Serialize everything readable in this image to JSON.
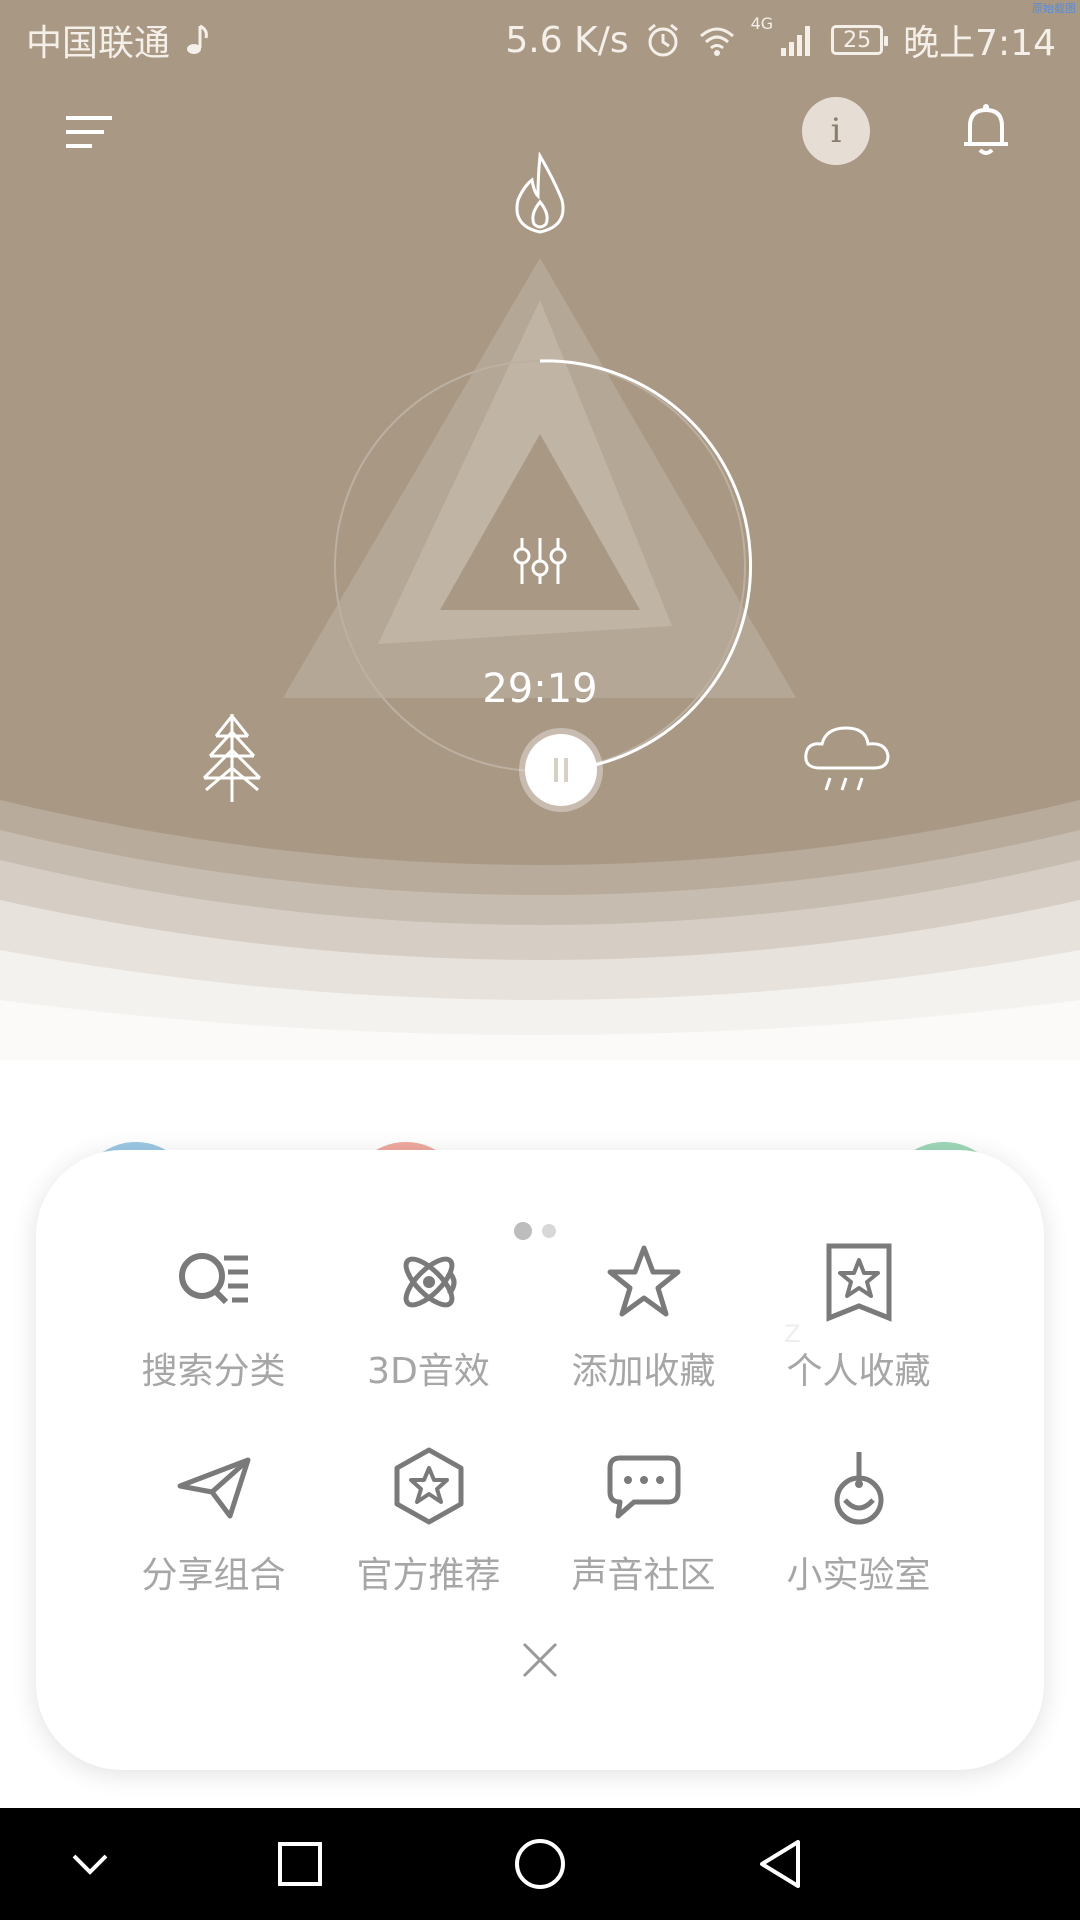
{
  "status_bar": {
    "carrier": "中国联通",
    "speed": "5.6 K/s",
    "network": "4G",
    "battery": "25",
    "time": "晚上7:14",
    "corner_tag": "原始截图"
  },
  "header": {
    "menu_icon": "menu-icon",
    "info_label": "i",
    "bell_icon": "bell-icon"
  },
  "player": {
    "timer": "29:19",
    "progress_fraction": 0.4,
    "state": "playing",
    "sounds": [
      "fire-icon",
      "tree-icon",
      "rain-icon"
    ]
  },
  "colors": {
    "hero_bg": "#a99984",
    "card_bg": "#ffffff",
    "label": "#a6a6a6",
    "icon": "#7a7a7a",
    "peek_blue": "#9cc9e6",
    "peek_red": "#f0a9a0",
    "peek_green": "#9fd8b9"
  },
  "menu": {
    "page_dots": 2,
    "active_page": 1,
    "items": [
      {
        "label": "搜索分类",
        "icon": "search-list-icon"
      },
      {
        "label": "3D音效",
        "icon": "atom-icon"
      },
      {
        "label": "添加收藏",
        "icon": "star-icon"
      },
      {
        "label": "个人收藏",
        "icon": "bookmark-star-icon"
      },
      {
        "label": "分享组合",
        "icon": "paper-plane-icon"
      },
      {
        "label": "官方推荐",
        "icon": "hexagon-star-icon"
      },
      {
        "label": "声音社区",
        "icon": "chat-bubble-icon"
      },
      {
        "label": "小实验室",
        "icon": "flask-icon"
      }
    ],
    "faint_text": "Z"
  },
  "nav_bar": {
    "buttons": [
      "collapse-icon",
      "recent-apps-icon",
      "home-icon",
      "back-icon"
    ]
  }
}
